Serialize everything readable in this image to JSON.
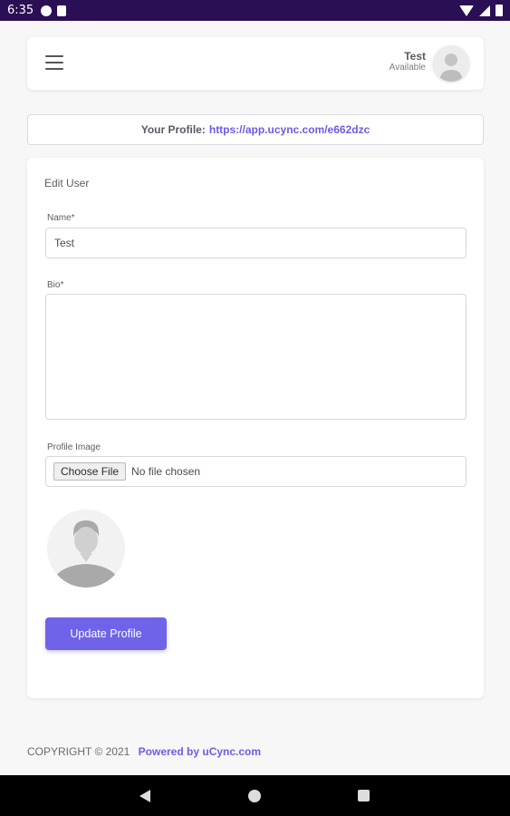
{
  "status_bar": {
    "time": "6:35"
  },
  "header": {
    "menu_icon": "hamburger-icon",
    "user_name": "Test",
    "user_status": "Available",
    "avatar_icon": "default-user-avatar"
  },
  "profile_link": {
    "label": "Your Profile:",
    "url": "https://app.ucync.com/e662dzc"
  },
  "form": {
    "title": "Edit User",
    "name_label": "Name*",
    "name_value": "Test",
    "bio_label": "Bio*",
    "bio_value": "",
    "image_label": "Profile Image",
    "choose_file_label": "Choose File",
    "no_file_text": "No file chosen",
    "submit_label": "Update Profile"
  },
  "footer": {
    "copyright": "COPYRIGHT © 2021",
    "powered_by": "Powered by uCync.com"
  },
  "nav_bar": {
    "back_icon": "back-icon",
    "home_icon": "home-icon",
    "recent_icon": "recent-apps-icon"
  },
  "colors": {
    "accent": "#6f63ea",
    "link": "#6b5ce7",
    "status_bar": "#2a0f55"
  }
}
